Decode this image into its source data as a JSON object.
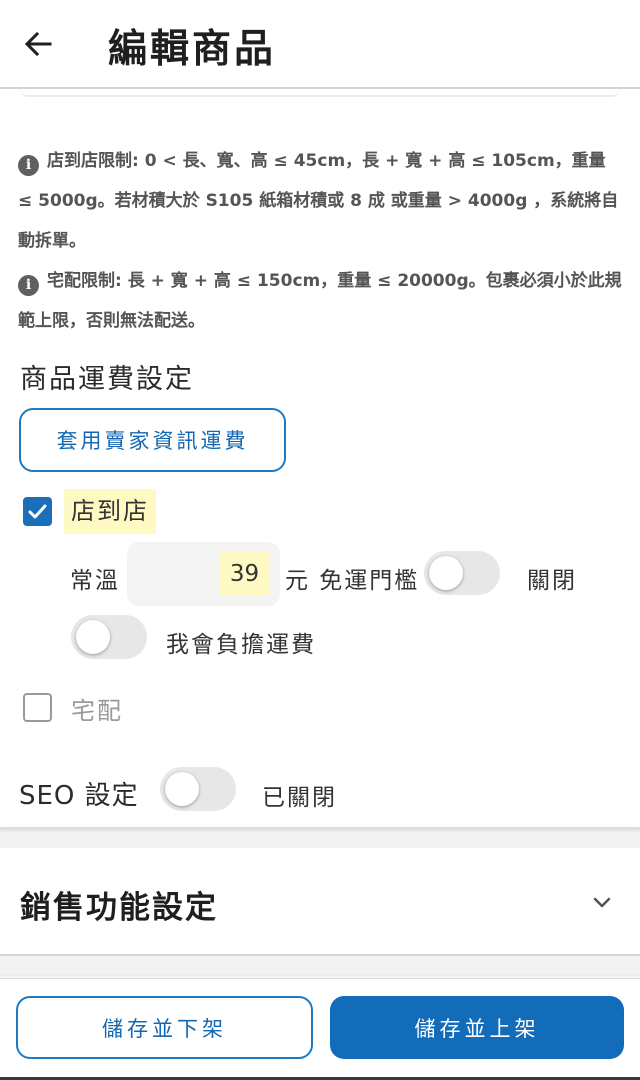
{
  "header": {
    "title": "編輯商品",
    "back_icon": "arrow-left-icon"
  },
  "notices": {
    "store_limit": "店到店限制: 0 < 長、寬、高 ≤ 45cm，長 + 寬 + 高 ≤ 105cm，重量 ≤ 5000g。若材積大於 S105 紙箱材積或 8 成 或重量 > 4000g ，系統將自動拆單。",
    "home_limit": "宅配限制: 長 + 寬 + 高 ≤ 150cm，重量 ≤ 20000g。包裹必須小於此規範上限，否則無法配送。",
    "icon": "info-icon"
  },
  "shipping": {
    "section_title": "商品運費設定",
    "apply_seller_button": "套用賣家資訊運費",
    "store_to_store": {
      "label": "店到店",
      "checked": true,
      "temp_label": "常溫",
      "price": "39",
      "currency_label": "元 免運門檻",
      "free_threshold_state": "關閉",
      "free_threshold_enabled": false,
      "bear_label": "我會負擔運費",
      "bear_enabled": false
    },
    "home_delivery": {
      "label": "宅配",
      "checked": false
    }
  },
  "seo": {
    "label": "SEO 設定",
    "state": "已關閉",
    "enabled": false
  },
  "sales": {
    "title": "銷售功能設定",
    "chevron_icon": "chevron-down-icon"
  },
  "footer": {
    "save_unpublish": "儲存並下架",
    "save_publish": "儲存並上架"
  },
  "colors": {
    "accent": "#136cb9",
    "highlight": "#fffac4"
  }
}
